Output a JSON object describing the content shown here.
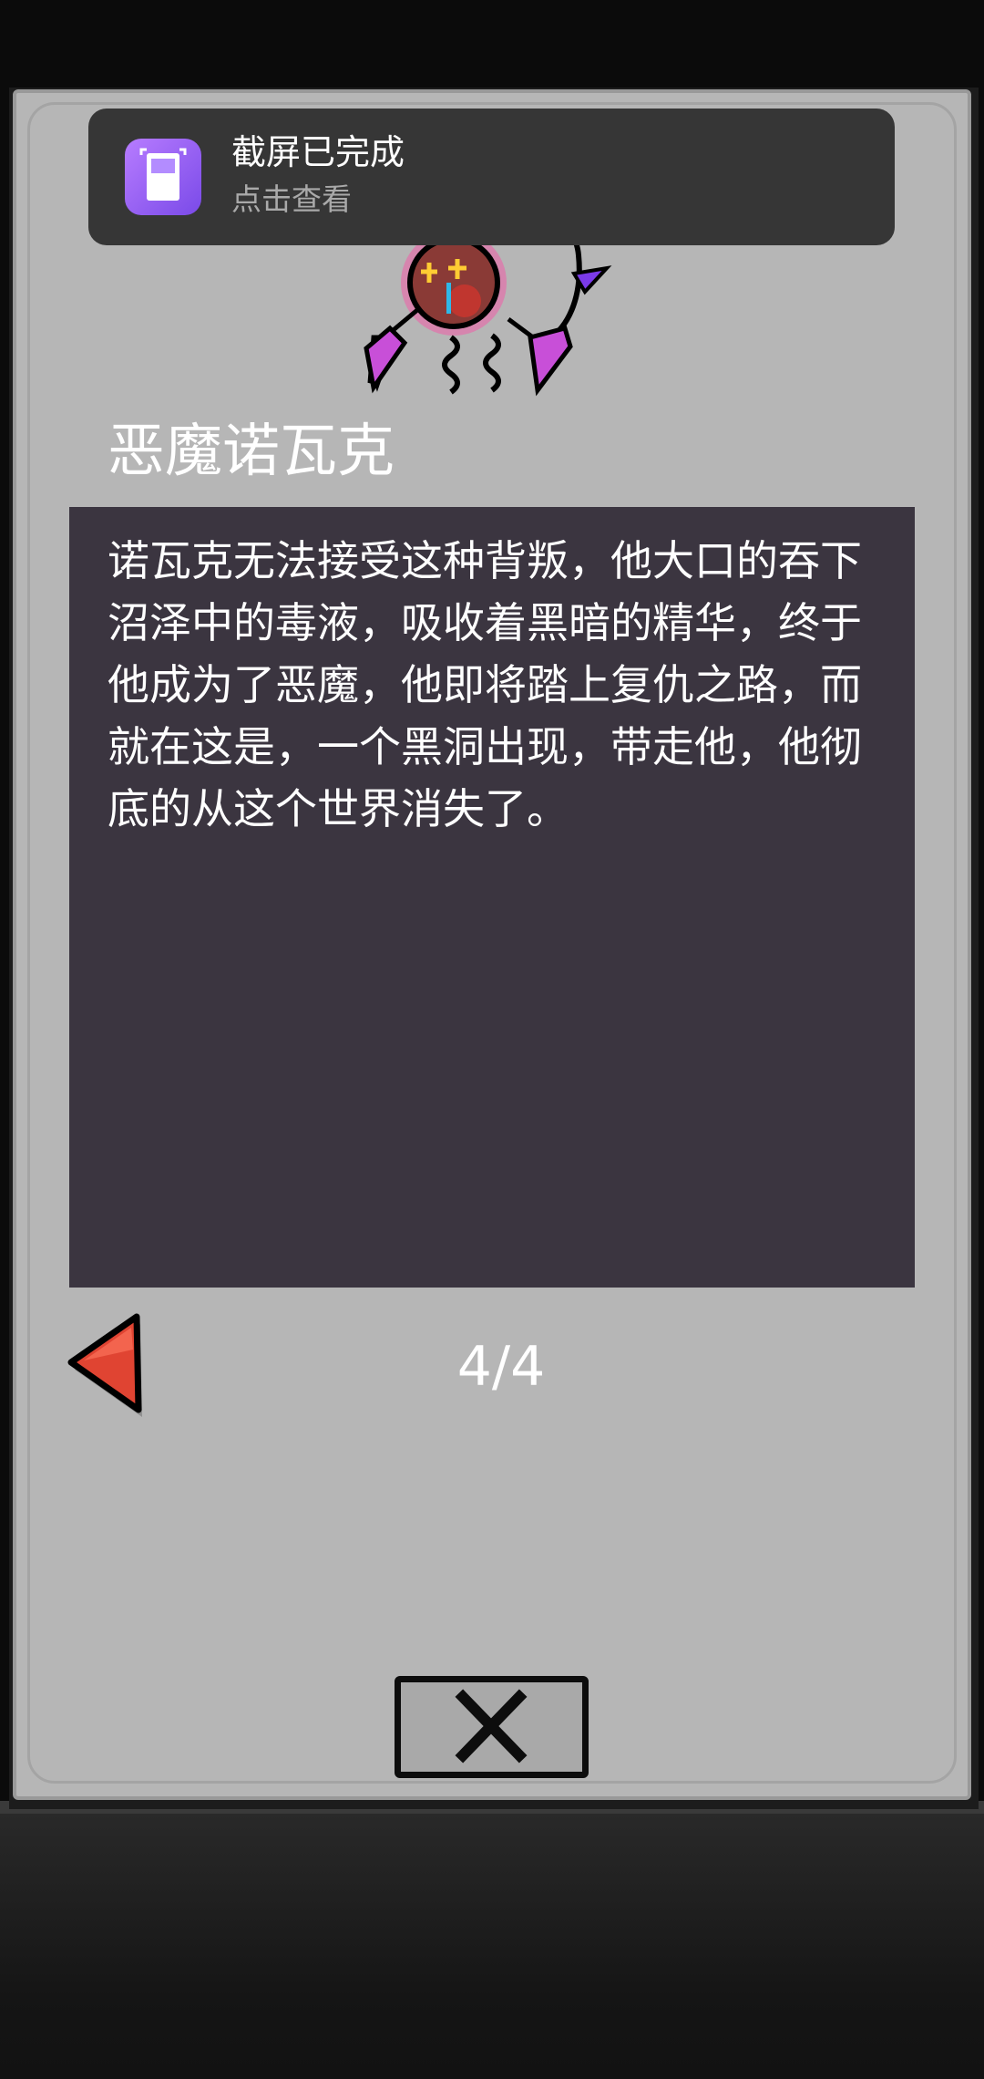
{
  "notification": {
    "title": "截屏已完成",
    "subtitle": "点击查看",
    "icon": "screenshot-gallery-icon",
    "icon_color": "#9b65f5"
  },
  "entry": {
    "name": "恶魔诺瓦克",
    "story": "诺瓦克无法接受这种背叛，他大口的吞下沼泽中的毒液，吸收着黑暗的精华，终于他成为了恶魔，他即将踏上复仇之路，而就在这是，一个黑洞出现，带走他，他彻底的从这个世界消失了。",
    "portrait_icon": "demon-novak-sprite"
  },
  "pagination": {
    "label": "4/4",
    "prev_icon": "red-left-arrow-icon"
  },
  "close": {
    "icon": "close-x-icon"
  },
  "colors": {
    "panel": "#b6b6b6",
    "story_box": "#3b3540",
    "text": "#ffffff",
    "arrow": "#e04432"
  }
}
